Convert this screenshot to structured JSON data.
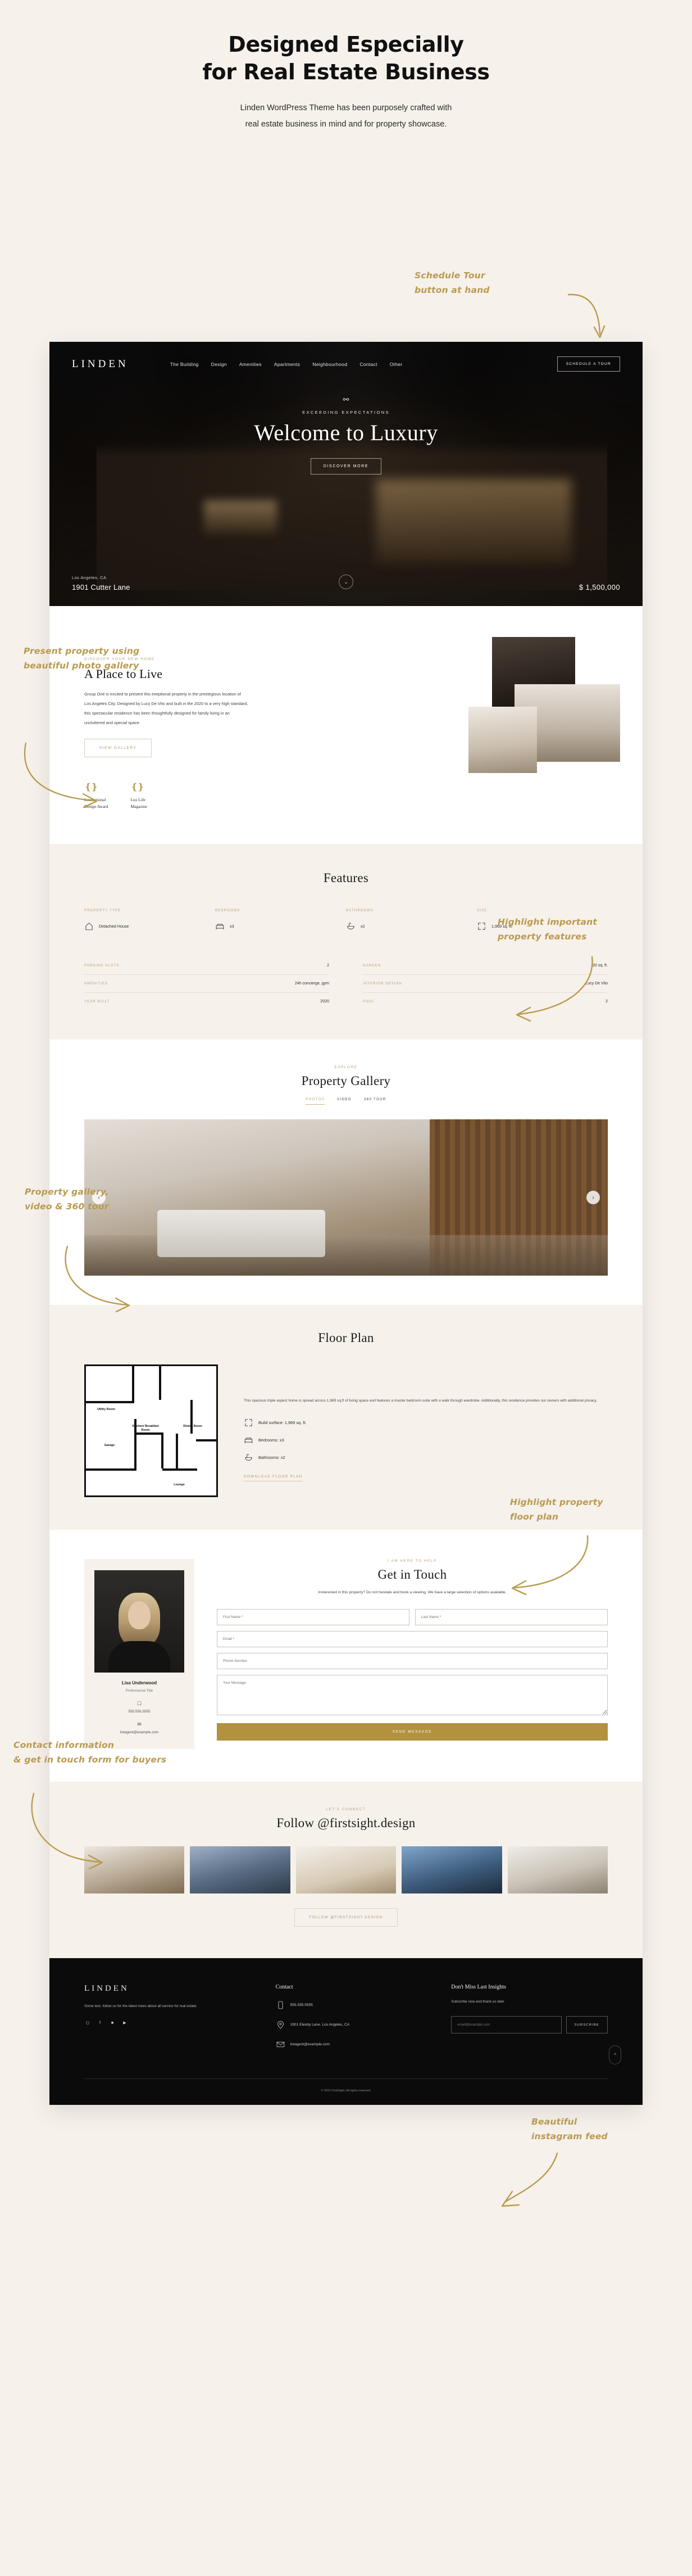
{
  "promo": {
    "title_line1": "Designed Especially",
    "title_line2": "for Real Estate Business",
    "sub_line1": "Linden WordPress Theme has been purposely crafted with",
    "sub_line2": "real estate business in mind and for property showcase."
  },
  "notes": {
    "schedule": "Schedule Tour\nbutton at hand",
    "gallery_photo": "Present property using\nbeautiful photo gallery",
    "features": "Highlight important\nproperty features",
    "gallery_video": "Property gallery,\nvideo & 360 tour",
    "floorplan": "Highlight property\nfloor plan",
    "contact": "Contact information\n& get in touch form for buyers",
    "instagram": "Beautiful\ninstagram feed"
  },
  "site": {
    "logo": "LINDEN",
    "nav": [
      "The Building",
      "Design",
      "Amenities",
      "Apartments",
      "Neighbourhood",
      "Contact",
      "Other"
    ],
    "schedule_button": "SCHEDULE A TOUR",
    "hero": {
      "eyebrow": "EXCEEDING EXPECTATIONS",
      "title": "Welcome to Luxury",
      "cta": "DISCOVER MORE",
      "city": "Los Angeles, CA",
      "address": "1901 Cutter Lane",
      "price": "$ 1,500,000",
      "scroll_icon": "chevron-down"
    },
    "place": {
      "eyebrow": "DISCOVER YOUR NEW HOME",
      "title": "A Place to Live",
      "body": "Group One is excited to present this exeptional property in the prestegious location of Los Angeles City. Designed by Lucy De Vito and built in the 2020 to a very high standard, this spectacular residence has been thoughtfully designed for family living in an uncluttered and special space.",
      "cta": "VIEW GALLERY",
      "awards": [
        {
          "name": "International\nDesign Award"
        },
        {
          "name": "Lux Life\nMagazine"
        }
      ]
    },
    "features": {
      "title": "Features",
      "cards": [
        {
          "label": "PROPERTY TYPE",
          "value": "Detached House",
          "icon": "house-icon"
        },
        {
          "label": "BEDROOMS",
          "value": "x3",
          "icon": "bed-icon"
        },
        {
          "label": "BATHROOMS",
          "value": "x2",
          "icon": "bath-icon"
        },
        {
          "label": "SIZE",
          "value": "1,969 sq. ft.",
          "icon": "expand-icon"
        }
      ],
      "specs_left": [
        {
          "key": "PARKING SLOTS",
          "value": "2"
        },
        {
          "key": "AMENITIES",
          "value": "24h concierge, gym"
        },
        {
          "key": "YEAR BUILT",
          "value": "2020"
        }
      ],
      "specs_right": [
        {
          "key": "GARDEN",
          "value": "20 sq. ft."
        },
        {
          "key": "INTERIOR DESIGN",
          "value": "Lucy De Vito"
        },
        {
          "key": "POOL",
          "value": "2"
        }
      ]
    },
    "gallery": {
      "eyebrow": "EXPLORE",
      "title": "Property Gallery",
      "tabs": [
        "PHOTOS",
        "VIDEO",
        "360 TOUR"
      ],
      "active_tab": "PHOTOS",
      "prev_icon": "chevron-left",
      "next_icon": "chevron-right"
    },
    "floorplan": {
      "title": "Floor Plan",
      "rooms": [
        "Utility Room",
        "Kitchen/ Breakfast Room",
        "Dining Room",
        "Garage",
        "Lounge"
      ],
      "body": "This spacious triple aspect home is spread across 1,969 sq.ft of living space and features a master bedroom suite with a walk through wardrobe. Additionally, this residence provides our owners with additional privacy.",
      "items": [
        {
          "icon": "expand-icon",
          "text": "Build surface: 1,969 sq. ft."
        },
        {
          "icon": "bed-icon",
          "text": "Bedrooms: x3"
        },
        {
          "icon": "bath-icon",
          "text": "Bathrooms: x2"
        }
      ],
      "download": "DOWNLOAD FLOOR PLAN"
    },
    "contact": {
      "agent": {
        "name": "Lisa Underwood",
        "role": "Professional Title",
        "phone_icon": "phone-icon",
        "phone": "555.555.5555",
        "email_icon": "mail-icon",
        "email": "listagent@example.com"
      },
      "eyebrow": "I AM HERE TO HELP",
      "title": "Get in Touch",
      "lead": "Insterested in this property? Do not hesitate and book a viewing. We have a large selection of options available.",
      "fields": {
        "first_name": "First Name *",
        "last_name": "Last Name *",
        "email": "Email *",
        "phone": "Phone Number",
        "message": "Your Message"
      },
      "submit": "SEND MESSAGE"
    },
    "instagram": {
      "eyebrow": "LET'S CONNECT",
      "title": "Follow @firstsight.design",
      "cta": "FOLLOW @FIRSTSIGHT.DESIGN",
      "tiles": [
        "tile-1",
        "tile-2",
        "tile-3",
        "tile-4",
        "tile-5"
      ]
    },
    "footer": {
      "logo": "LINDEN",
      "about": "Some text, follow us for the latest news about all service for real estate",
      "social": [
        "instagram-icon",
        "facebook-icon",
        "linkedin-icon",
        "youtube-icon"
      ],
      "contact_heading": "Contact",
      "phone_icon": "phone-icon",
      "phone": "555.555.5555",
      "address_icon": "pin-icon",
      "address": "1901 Elendy Lane. Los Angeles, CA",
      "email_icon": "mail-icon",
      "email": "listagent@example.com",
      "news_heading": "Don't Miss Last Insights",
      "news_sub": "Subscribe now and thank us later",
      "news_placeholder": "email@example.com",
      "news_button": "SUBSCRIBE",
      "copyright": "© 2021 FirstSight. All rights reserved.",
      "to_top_icon": "chevron-up"
    }
  },
  "colors": {
    "gold": "#b99a4e",
    "cream": "#f7f1ec",
    "ink": "#0b0b0b",
    "brass": "#b2913f"
  }
}
